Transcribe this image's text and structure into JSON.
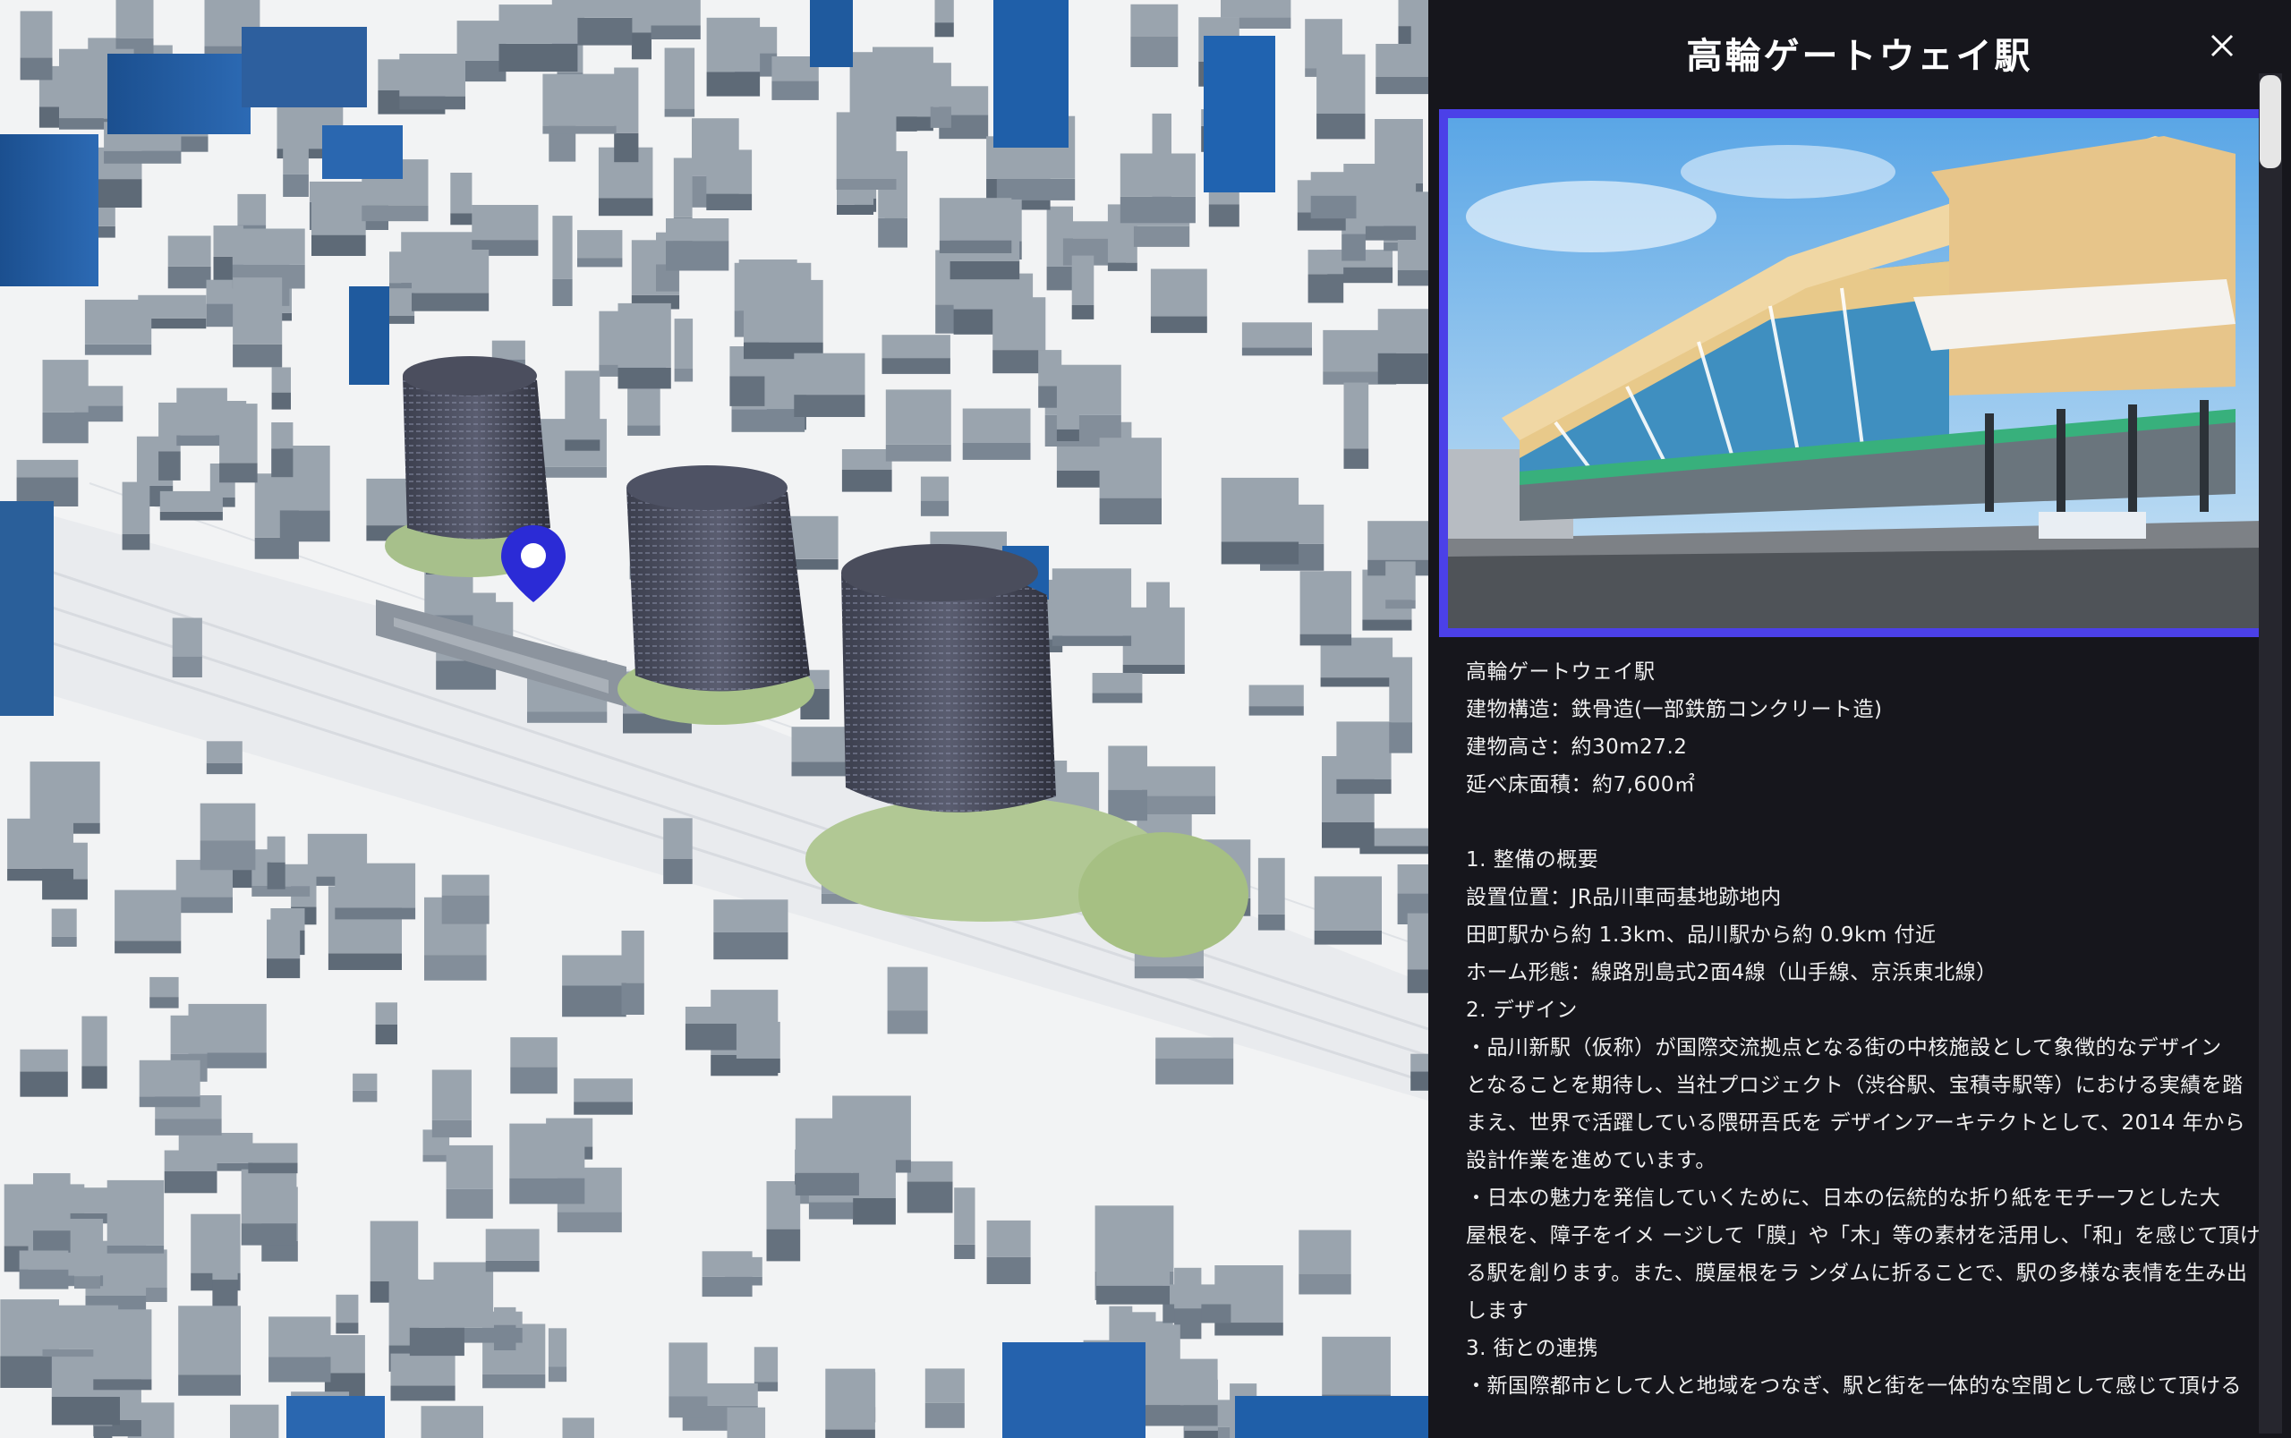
{
  "panel": {
    "title": "高輪ゲートウェイ駅",
    "close_icon": "close-icon",
    "photo_alt": "station-photo",
    "description": [
      "高輪ゲートウェイ駅",
      "建物構造：鉄骨造(一部鉄筋コンクリート造)",
      "建物高さ：約30m27.2",
      "延べ床面積：約7,600㎡",
      "",
      "1. 整備の概要",
      "設置位置：JR品川車両基地跡地内",
      "田町駅から約 1.3km、品川駅から約 0.9km 付近",
      "ホーム形態：線路別島式2面4線（山手線、京浜東北線）",
      "2. デザイン",
      "・品川新駅（仮称）が国際交流拠点となる街の中核施設として象徴的なデザイン",
      "となることを期待し、当社プロジェクト（渋谷駅、宝積寺駅等）における実績を踏",
      "まえ、世界で活躍している隈研吾氏を デザインアーキテクトとして、2014 年から",
      "設計作業を進めています。",
      "・日本の魅力を発信していくために、日本の伝統的な折り紙をモチーフとした大",
      "屋根を、障子をイメ ージして「膜」や「木」等の素材を活用し、「和」を感じて頂け",
      "る駅を創ります。また、膜屋根をラ ンダムに折ることで、駅の多様な表情を生み出",
      "します",
      "3. 街との連携",
      "・新国際都市として人と地域をつなぎ、駅と街を一体的な空間として感じて頂ける"
    ]
  },
  "map": {
    "marker_icon": "map-pin-icon",
    "marker_color": "#2b2bd6",
    "building_color": "#6f7b88",
    "highlight_color": "#1f5a9e"
  }
}
